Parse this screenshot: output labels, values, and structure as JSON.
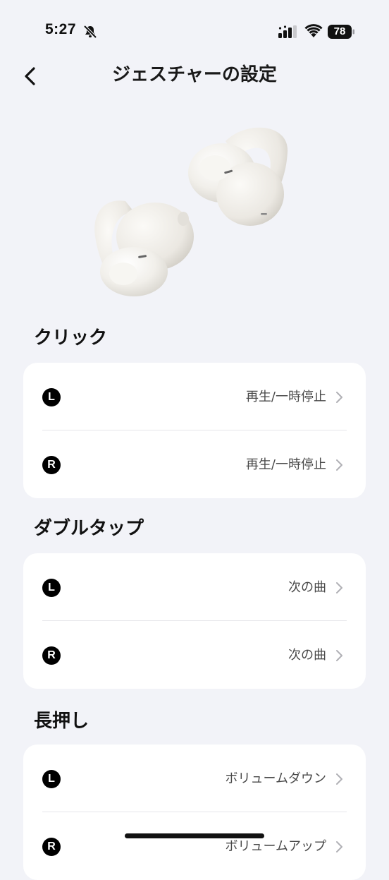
{
  "status_bar": {
    "time": "5:27",
    "battery": "78",
    "icons": [
      "bell-slash-icon",
      "signal-icon",
      "wifi-icon",
      "battery-icon"
    ]
  },
  "header": {
    "title": "ジェスチャーの設定",
    "back_icon": "chevron-left-icon"
  },
  "product": {
    "image": "earbuds-image"
  },
  "sections": [
    {
      "title": "クリック",
      "rows": [
        {
          "side": "L",
          "value": "再生/一時停止"
        },
        {
          "side": "R",
          "value": "再生/一時停止"
        }
      ]
    },
    {
      "title": "ダブルタップ",
      "rows": [
        {
          "side": "L",
          "value": "次の曲"
        },
        {
          "side": "R",
          "value": "次の曲"
        }
      ]
    },
    {
      "title": "長押し",
      "rows": [
        {
          "side": "L",
          "value": "ボリュームダウン"
        },
        {
          "side": "R",
          "value": "ボリュームアップ"
        }
      ]
    }
  ],
  "colors": {
    "background": "#f2f3f8",
    "card": "#ffffff",
    "badge": "#000000",
    "value_text": "#4a4a4a",
    "chevron": "#b0b0b5"
  }
}
